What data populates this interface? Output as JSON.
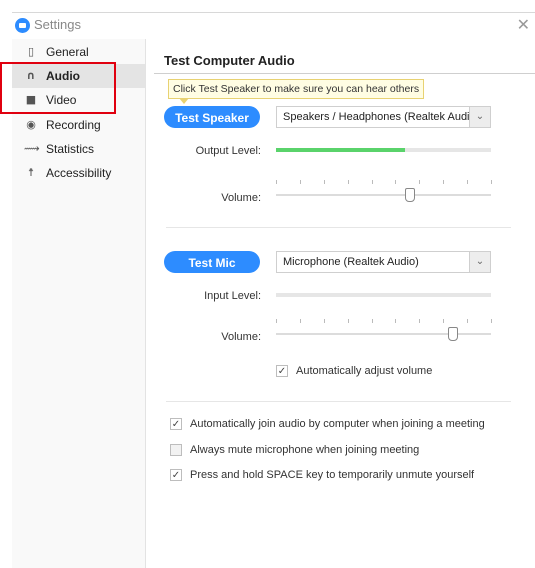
{
  "window": {
    "title": "Settings"
  },
  "sidebar": {
    "items": [
      {
        "label": "General",
        "icon": "general-icon"
      },
      {
        "label": "Audio",
        "icon": "headphones-icon",
        "active": true
      },
      {
        "label": "Video",
        "icon": "camera-icon"
      },
      {
        "label": "Recording",
        "icon": "record-icon"
      },
      {
        "label": "Statistics",
        "icon": "statistics-icon"
      },
      {
        "label": "Accessibility",
        "icon": "accessibility-icon"
      }
    ]
  },
  "main": {
    "section_title": "Test Computer Audio",
    "tooltip": "Click Test Speaker to make sure you can hear others",
    "speaker": {
      "button_label": "Test Speaker",
      "device": "Speakers / Headphones (Realtek Audio)",
      "output_level_label": "Output Level:",
      "output_level": 0.6,
      "volume_label": "Volume:",
      "volume": 0.62
    },
    "mic": {
      "button_label": "Test Mic",
      "device": "Microphone (Realtek Audio)",
      "input_level_label": "Input Level:",
      "input_level": 0,
      "volume_label": "Volume:",
      "volume": 0.82,
      "auto_adjust_label": "Automatically adjust volume",
      "auto_adjust_checked": true
    },
    "options": [
      {
        "label": "Automatically join audio by computer when joining a meeting",
        "checked": true
      },
      {
        "label": "Always mute microphone when joining meeting",
        "checked": false
      },
      {
        "label": "Press and hold SPACE key to temporarily unmute yourself",
        "checked": true
      }
    ]
  },
  "colors": {
    "accent": "#2d8cff",
    "level_fill": "#5ad36b",
    "annotation_box": "#e0000f",
    "tooltip_bg": "#fffde3"
  }
}
